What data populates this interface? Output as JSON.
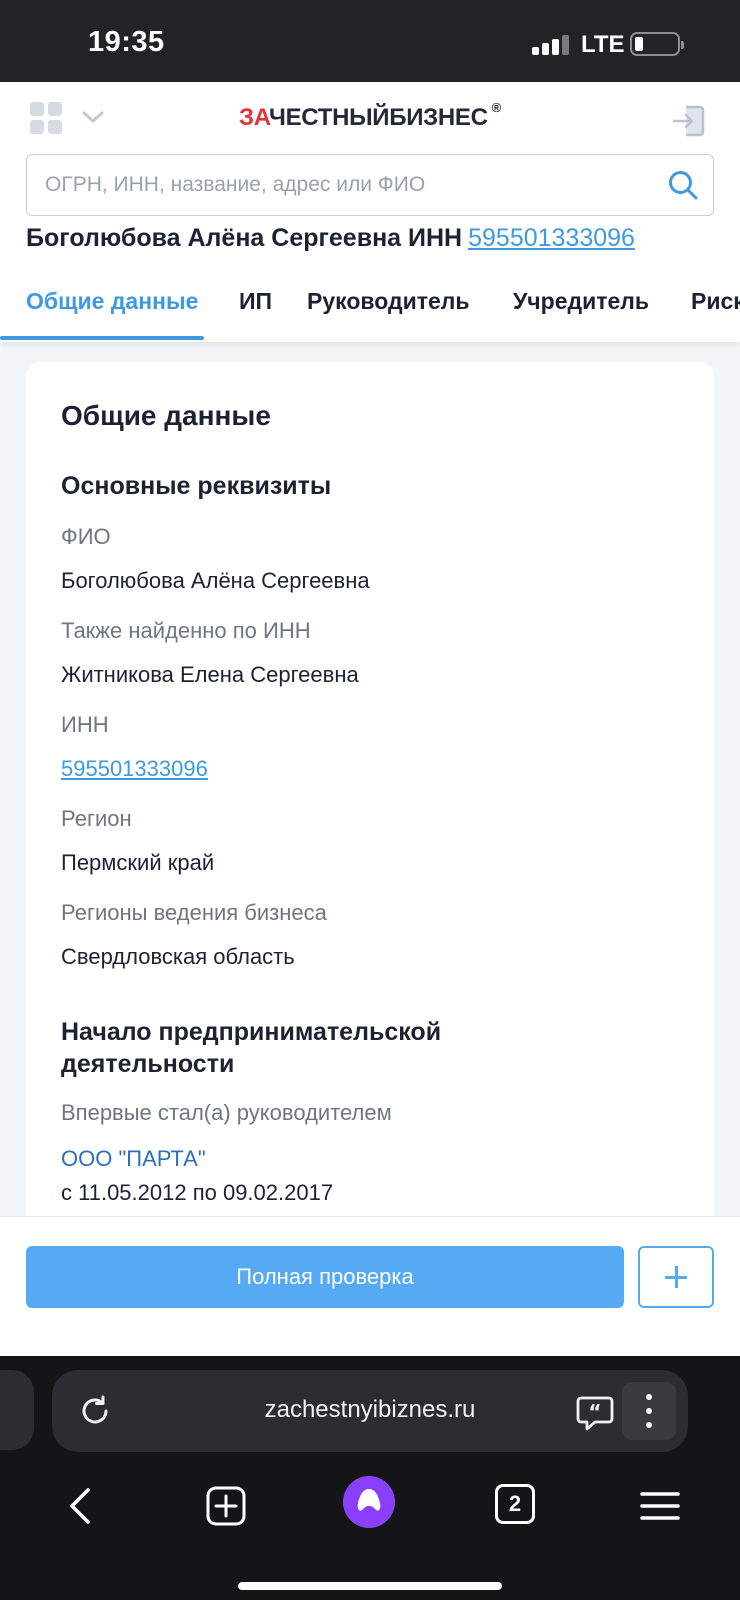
{
  "status": {
    "time": "19:35",
    "network": "LTE"
  },
  "header": {
    "logo_accent": "ЗА",
    "logo_main": "ЧЕСТНЫЙБИЗНЕС",
    "logo_mark": "®",
    "search_placeholder": "ОГРН, ИНН, название, адрес или ФИО"
  },
  "person": {
    "name": "Боголюбова Алёна Сергеевна ИНН",
    "inn": "595501333096"
  },
  "tabs": [
    {
      "label": "Общие данные",
      "active": true
    },
    {
      "label": "ИП",
      "active": false
    },
    {
      "label": "Руководитель",
      "active": false
    },
    {
      "label": "Учредитель",
      "active": false
    },
    {
      "label": "Риск",
      "active": false
    }
  ],
  "card": {
    "title": "Общие данные",
    "section1_title": "Основные реквизиты",
    "fields": [
      {
        "label": "ФИО",
        "value": "Боголюбова Алёна Сергеевна"
      },
      {
        "label": "Также найденно по ИНН",
        "value": "Житникова Елена Сергеевна"
      },
      {
        "label": "ИНН",
        "value": "595501333096"
      },
      {
        "label": "Регион",
        "value": "Пермский край"
      },
      {
        "label": "Регионы ведения бизнеса",
        "value": "Свердловская область"
      }
    ],
    "section2_title_line1": "Начало предпринимательской",
    "section2_title_line2": "деятельности",
    "first_director_label": "Впервые стал(а) руководителем",
    "first_director_company": "ООО \"ПАРТА\"",
    "first_director_period": "с 11.05.2012 по 09.02.2017"
  },
  "actions": {
    "full_check": "Полная проверка"
  },
  "browser": {
    "url": "zachestnyibiznes.ru",
    "tab_count": "2"
  },
  "colors": {
    "accent": "#3e9ae0",
    "brand_red": "#e0343c",
    "button": "#55aaf3",
    "alice": "#8a3ffc"
  }
}
